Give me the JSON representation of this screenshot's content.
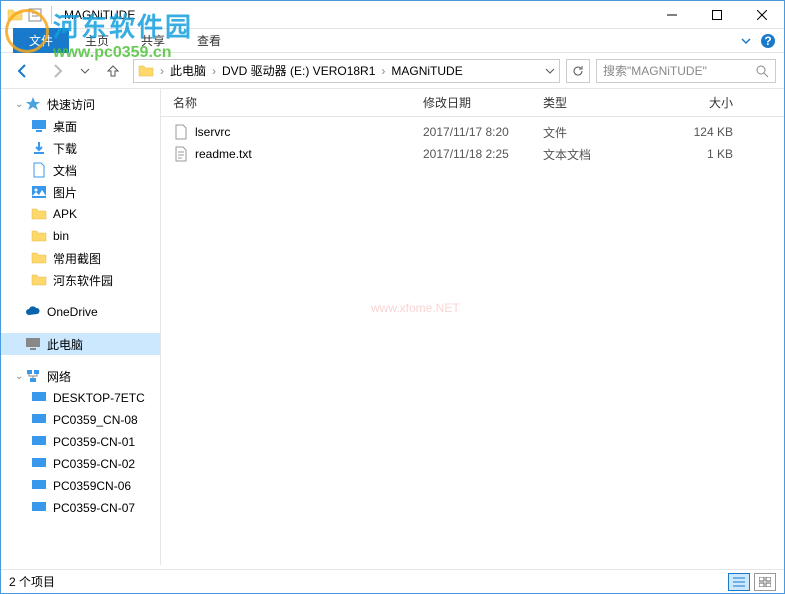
{
  "window": {
    "title": "MAGNiTUDE"
  },
  "ribbon": {
    "file": "主页",
    "file_prefix": "文件",
    "share": "共享",
    "view": "查看"
  },
  "breadcrumbs": [
    "此电脑",
    "DVD 驱动器 (E:) VERO18R1",
    "MAGNiTUDE"
  ],
  "search": {
    "placeholder": "搜索\"MAGNiTUDE\""
  },
  "sidebar": {
    "quick": {
      "label": "快速访问",
      "items": [
        "桌面",
        "下载",
        "文档",
        "图片",
        "APK",
        "bin",
        "常用截图",
        "河东软件园"
      ]
    },
    "onedrive": "OneDrive",
    "thispc": "此电脑",
    "network": {
      "label": "网络",
      "items": [
        "DESKTOP-7ETC",
        "PC0359_CN-08",
        "PC0359-CN-01",
        "PC0359-CN-02",
        "PC0359CN-06",
        "PC0359-CN-07"
      ]
    }
  },
  "columns": {
    "name": "名称",
    "date": "修改日期",
    "type": "类型",
    "size": "大小"
  },
  "files": [
    {
      "name": "lservrc",
      "date": "2017/11/17 8:20",
      "type": "文件",
      "size": "124 KB"
    },
    {
      "name": "readme.txt",
      "date": "2017/11/18 2:25",
      "type": "文本文档",
      "size": "1 KB"
    }
  ],
  "status": {
    "count": "2 个项目"
  },
  "watermark": {
    "line1": "河东软件园",
    "line2": "www.pc0359.cn",
    "center": "www.xfome.NET"
  }
}
